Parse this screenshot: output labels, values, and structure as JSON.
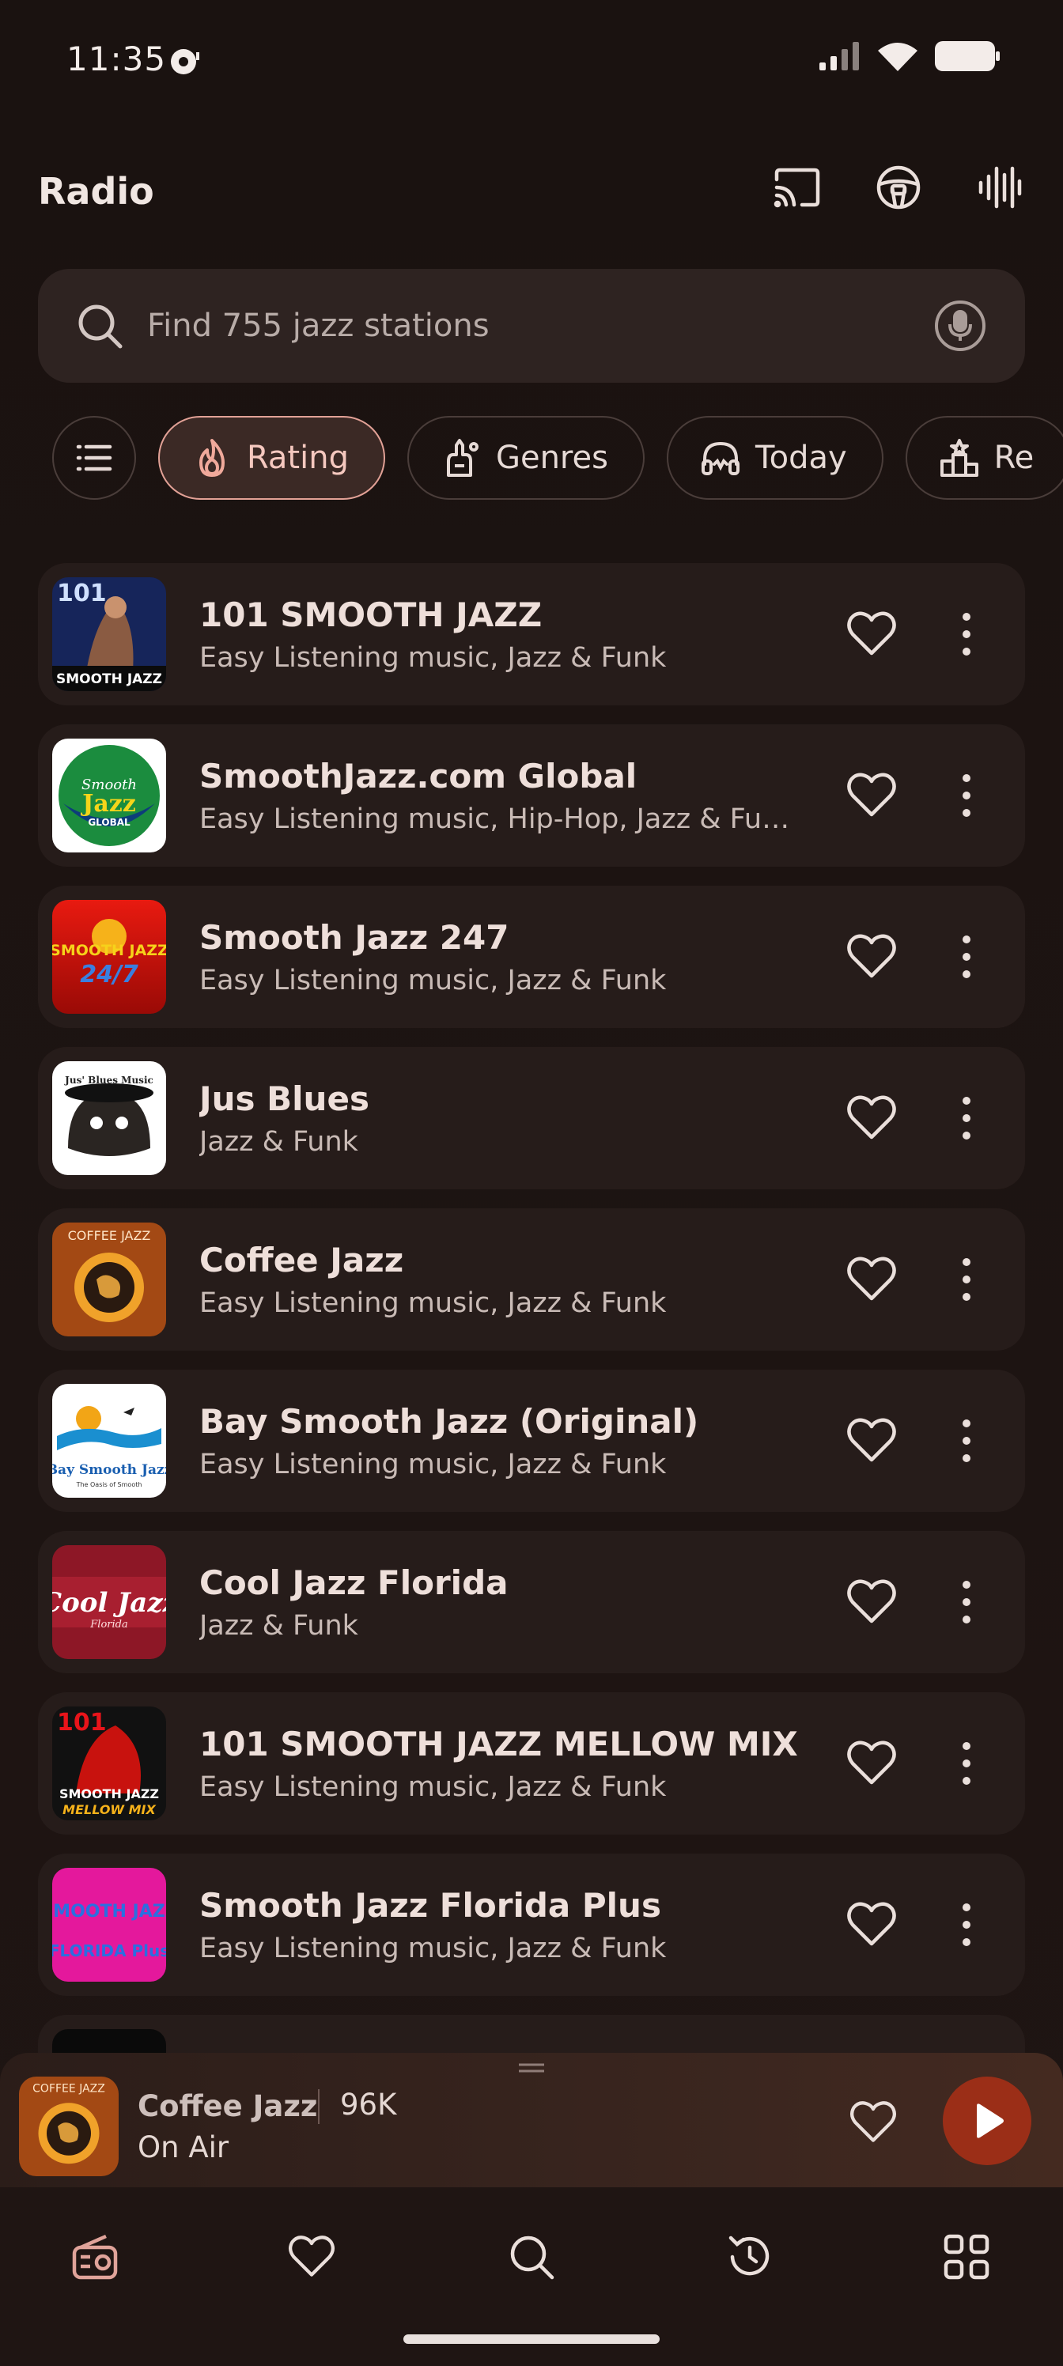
{
  "status_bar": {
    "time": "11:35",
    "icons": [
      "podcast-notification-icon",
      "signal-icon",
      "wifi-icon",
      "battery-icon"
    ]
  },
  "app_bar": {
    "title": "Radio",
    "actions": [
      "cast-icon",
      "car-mode-icon",
      "equalizer-icon"
    ]
  },
  "search": {
    "placeholder": "Find 755 jazz stations",
    "icons": [
      "search-icon",
      "mic-icon"
    ]
  },
  "filters": {
    "chips": [
      {
        "label": "Rating",
        "icon": "fire-icon",
        "active": true
      },
      {
        "label": "Genres",
        "icon": "guitar-icon",
        "active": false
      },
      {
        "label": "Today",
        "icon": "headphones-icon",
        "active": false
      },
      {
        "label": "Re",
        "icon": "podium-icon",
        "active": false
      }
    ]
  },
  "stations": [
    {
      "name": "101 SMOOTH JAZZ",
      "genre": "Easy Listening music, Jazz & Funk",
      "logo_text": "101",
      "logo_sub": "SMOOTH JAZZ",
      "logo_colors": [
        "#1a2c6c",
        "#6a4a3a"
      ]
    },
    {
      "name": "SmoothJazz.com Global",
      "genre": "Easy Listening music, Hip-Hop, Jazz & Fun…",
      "logo_text": "Smooth Jazz",
      "logo_sub": "GLOBAL",
      "logo_colors": [
        "#178a3a",
        "#0d3d7a"
      ]
    },
    {
      "name": "Smooth Jazz 247",
      "genre": "Easy Listening music, Jazz & Funk",
      "logo_text": "SMOOTH JAZZ",
      "logo_sub": "24/7",
      "logo_colors": [
        "#c81e0e",
        "#f6a21a"
      ]
    },
    {
      "name": "Jus Blues",
      "genre": "Jazz & Funk",
      "logo_text": "Jus' Blues Music Foundation",
      "logo_sub": "",
      "logo_colors": [
        "#ffffff",
        "#222222"
      ]
    },
    {
      "name": "Coffee Jazz",
      "genre": "Easy Listening music, Jazz & Funk",
      "logo_text": "COFFEE JAZZ",
      "logo_sub": "",
      "logo_colors": [
        "#a24a16",
        "#e89a2a"
      ]
    },
    {
      "name": "Bay Smooth Jazz (Original)",
      "genre": "Easy Listening music, Jazz & Funk",
      "logo_text": "Bay Smooth Jazz",
      "logo_sub": "The Oasis of Smooth",
      "logo_colors": [
        "#ffffff",
        "#1a5fb0"
      ]
    },
    {
      "name": "Cool Jazz Florida",
      "genre": "Jazz & Funk",
      "logo_text": "Cool Jazz",
      "logo_sub": "Florida",
      "logo_colors": [
        "#9a1b2a",
        "#5a0e16"
      ]
    },
    {
      "name": "101 SMOOTH JAZZ MELLOW MIX",
      "genre": "Easy Listening music, Jazz & Funk",
      "logo_text": "101",
      "logo_sub": "SMOOTH JAZZ",
      "logo_sub2": "MELLOW MIX",
      "logo_colors": [
        "#d01010",
        "#111111"
      ]
    },
    {
      "name": "Smooth Jazz Florida Plus",
      "genre": "Easy Listening music, Jazz & Funk",
      "logo_text": "SMOOTH JAZZ",
      "logo_sub": "FLORIDA Plus",
      "logo_colors": [
        "#e0189a",
        "#2a6fe0"
      ]
    }
  ],
  "mini_player": {
    "title": "Coffee Jazz",
    "bitrate": "96K",
    "status": "On Air",
    "logo_text": "COFFEE JAZZ",
    "accent": "#9b2e17"
  },
  "bottom_nav": {
    "items": [
      "radio-icon",
      "favorites-icon",
      "search-icon",
      "history-icon",
      "more-apps-icon"
    ]
  },
  "colors": {
    "background": "#1b1311",
    "card": "#261c1a",
    "chip_active_border": "#e2a196",
    "play_button": "#9b2e17"
  }
}
